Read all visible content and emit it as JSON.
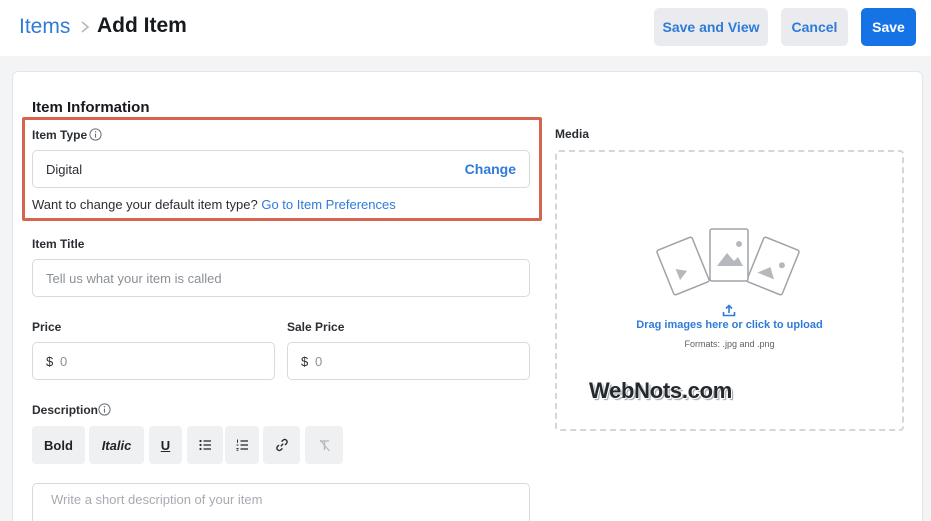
{
  "header": {
    "breadcrumb_root": "Items",
    "page_title": "Add Item",
    "save_and_view_label": "Save and View",
    "cancel_label": "Cancel",
    "save_label": "Save"
  },
  "form": {
    "section_title": "Item Information",
    "item_type": {
      "label": "Item Type",
      "value": "Digital",
      "change_label": "Change",
      "hint_text": "Want to change your default item type?",
      "hint_link": "Go to Item Preferences"
    },
    "item_title": {
      "label": "Item Title",
      "placeholder": "Tell us what your item is called"
    },
    "price": {
      "label": "Price",
      "currency": "$",
      "value": "0"
    },
    "sale_price": {
      "label": "Sale Price",
      "currency": "$",
      "value": "0"
    },
    "description": {
      "label": "Description",
      "toolbar": {
        "bold": "Bold",
        "italic": "Italic",
        "underline": "U"
      },
      "placeholder": "Write a short description of your item"
    }
  },
  "media": {
    "label": "Media",
    "upload_text": "Drag images here or click to upload",
    "formats_text": "Formats: .jpg and .png"
  },
  "watermark": "WebNots.com",
  "colors": {
    "accent": "#2f7bd8",
    "primary_button": "#1673e6",
    "highlight_border": "#d6654f"
  }
}
